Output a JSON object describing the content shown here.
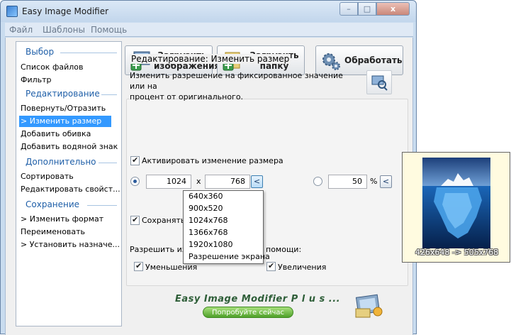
{
  "window": {
    "title": "Easy Image Modifier",
    "close_label": "x"
  },
  "menu": [
    "Файл",
    "Шаблоны",
    "Помощь"
  ],
  "sidebar": {
    "sections": [
      {
        "title": "Выбор",
        "items": [
          "Список файлов",
          "Фильтр"
        ]
      },
      {
        "title": "Редактирование",
        "items": [
          "Повернуть/Отразить",
          "> Изменить размер",
          "Добавить обивка",
          "Добавить водяной знак"
        ]
      },
      {
        "title": "Дополнительно",
        "items": [
          "Сортировать",
          "Редактировать свойст..."
        ]
      },
      {
        "title": "Сохранение",
        "items": [
          "> Изменить формат",
          "Переименовать",
          "> Установить назначе..."
        ]
      }
    ],
    "active_item": "> Изменить размер"
  },
  "toolbar": {
    "load_images": [
      "Загрузить",
      "изображения"
    ],
    "load_folder": [
      "Загрузить",
      "папку"
    ],
    "process": "Обработать"
  },
  "resize": {
    "group_title": "Редактирование: Изменить размер",
    "description": [
      "Изменить разрешение на фиксированное значение или на",
      "процент от оригинального."
    ],
    "activate_label": "Активировать изменение размера",
    "width": "1024",
    "times": "x",
    "height": "768",
    "percent": "50",
    "percent_sign": "%",
    "arrow": "<",
    "keep_label_visible": "Сохранять",
    "allow_label_visible": "Разрешить изм",
    "allow_label_tail": "помощи:",
    "shrink_label": "Уменьшения",
    "enlarge_label": "Увеличения"
  },
  "dropdown": {
    "options": [
      "640x360",
      "900x520",
      "1024x768",
      "1366x768",
      "1920x1080",
      "Разрешение экрана"
    ]
  },
  "promo": {
    "title": "Easy Image Modifier P l u s ...",
    "button": "Попробуйте сейчас"
  },
  "preview": {
    "caption": "426x648 -> 505x768"
  },
  "colors": {
    "accent": "#3399ff",
    "section": "#1f5fa8",
    "promo": "#2e5e38"
  }
}
